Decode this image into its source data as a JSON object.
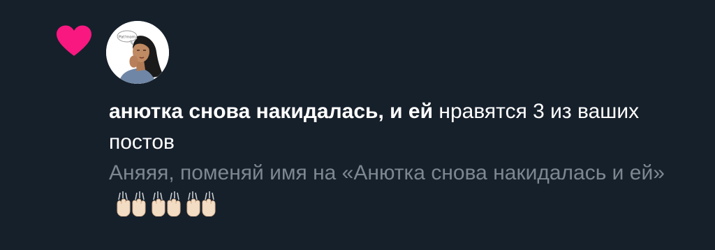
{
  "notification": {
    "type_icon": "heart-icon",
    "user_name": "анютка снова накидалась, и ей",
    "action_text": "нравятся 3 из ваших постов",
    "preview_text": "Аняяя, поменяй имя на «Анютка снова накидалась и ей»",
    "preview_emoji": [
      "raising-hands-emoji",
      "raising-hands-emoji",
      "raising-hands-emoji"
    ],
    "avatar_icon": "user-avatar-drawing",
    "avatar_caption": "Pat'mom"
  },
  "colors": {
    "background": "#16202b",
    "heart": "#f91880",
    "primary_text": "#ffffff",
    "secondary_text": "#7c8791"
  }
}
